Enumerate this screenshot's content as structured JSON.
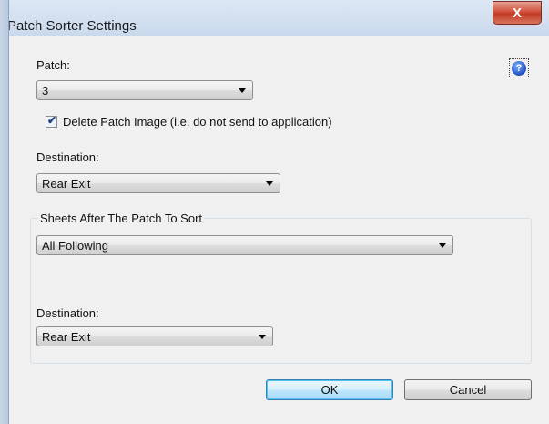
{
  "window": {
    "title": "Patch Sorter Settings",
    "close_glyph": "X"
  },
  "patch": {
    "label": "Patch:",
    "value": "3"
  },
  "help": {
    "glyph": "?"
  },
  "delete_patch": {
    "label": "Delete Patch Image (i.e. do not send to application)",
    "checked": true
  },
  "destination1": {
    "label": "Destination:",
    "value": "Rear Exit"
  },
  "sheets_group": {
    "title": "Sheets After The Patch To Sort",
    "sheets_value": "All Following",
    "destination_label": "Destination:",
    "destination_value": "Rear Exit"
  },
  "buttons": {
    "ok": "OK",
    "cancel": "Cancel"
  }
}
